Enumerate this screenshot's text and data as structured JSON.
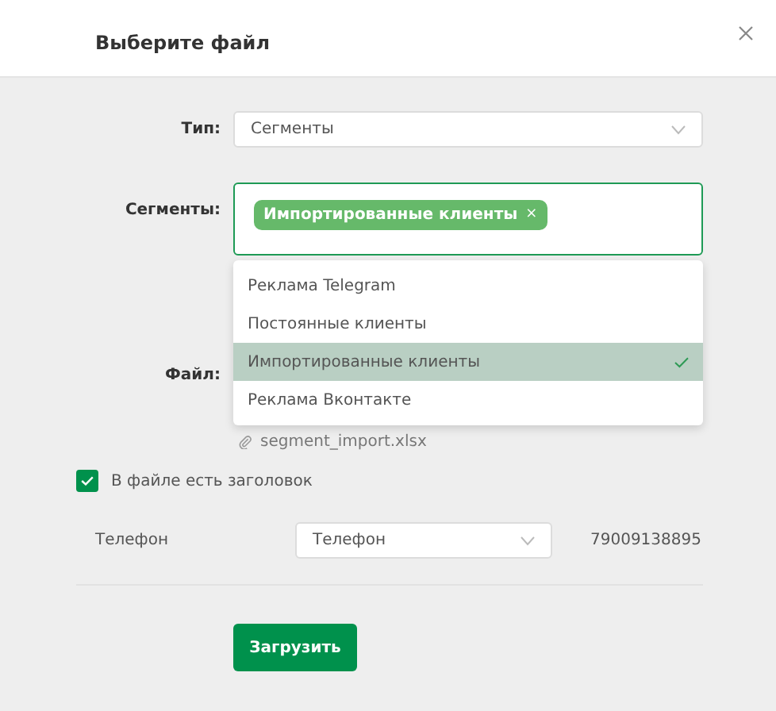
{
  "dialog": {
    "title": "Выберите файл"
  },
  "type_field": {
    "label": "Тип:",
    "value": "Сегменты"
  },
  "segments_field": {
    "label": "Сегменты:",
    "focused": true,
    "tags": [
      {
        "label": "Импортированные клиенты",
        "remove": "×"
      }
    ]
  },
  "segments_menu": {
    "open": true,
    "options": [
      {
        "label": "Реклама Telegram",
        "selected": false
      },
      {
        "label": "Постоянные клиенты",
        "selected": false
      },
      {
        "label": "Импортированные клиенты",
        "selected": true
      },
      {
        "label": "Реклама Вконтакте",
        "selected": false
      }
    ]
  },
  "file": {
    "label": "Файл:",
    "filename": "segment_import.xlsx"
  },
  "header_checkbox": {
    "label": "В файле есть заголовок",
    "checked": true
  },
  "mapping": [
    {
      "column": "Телефон",
      "field": "Телефон",
      "sample": "79009138895"
    }
  ],
  "submit": "Загрузить"
}
